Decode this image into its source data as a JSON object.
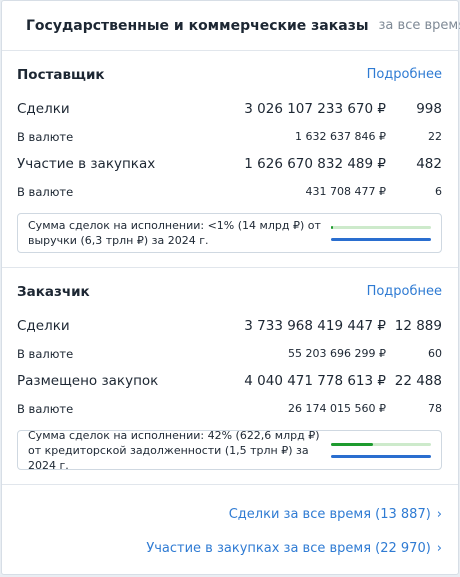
{
  "header": {
    "title": "Государственные и коммерческие заказы",
    "period": "за все время"
  },
  "supplier": {
    "title": "Поставщик",
    "more": "Подробнее",
    "rows": [
      {
        "label": "Сделки",
        "amount": "3 026 107 233 670 ₽",
        "count": "998",
        "size": "big"
      },
      {
        "label": "В валюте",
        "amount": "1 632 637 846 ₽",
        "count": "22",
        "size": "small"
      },
      {
        "label": "Участие в закупках",
        "amount": "1 626 670 832 489 ₽",
        "count": "482",
        "size": "big"
      },
      {
        "label": "В валюте",
        "amount": "431 708 477 ₽",
        "count": "6",
        "size": "small"
      }
    ],
    "info_text": "Сумма сделок на исполнении: <1% (14 млрд ₽) от выручки (6,3 трлн ₽) за 2024 г.",
    "progress": 0.01
  },
  "customer": {
    "title": "Заказчик",
    "more": "Подробнее",
    "rows": [
      {
        "label": "Сделки",
        "amount": "3 733 968 419 447 ₽",
        "count": "12 889",
        "size": "big"
      },
      {
        "label": "В валюте",
        "amount": "55 203 696 299 ₽",
        "count": "60",
        "size": "small"
      },
      {
        "label": "Размещено закупок",
        "amount": "4 040 471 778 613 ₽",
        "count": "22 488",
        "size": "big"
      },
      {
        "label": "В валюте",
        "amount": "26 174 015 560 ₽",
        "count": "78",
        "size": "small"
      }
    ],
    "info_text": "Сумма сделок на исполнении: 42% (622,6 млрд ₽) от кредиторской задолженности (1,5 трлн ₽) за 2024 г.",
    "progress": 0.42
  },
  "footer": {
    "deals_link": "Сделки за все время (13 887)",
    "participation_link": "Участие в закупках за все время (22 970)"
  },
  "colors": {
    "link": "#2f7bd3",
    "progress_green": "#1e9b2f",
    "progress_track": "#cdeacb",
    "progress_blue": "#2a6ecf"
  }
}
